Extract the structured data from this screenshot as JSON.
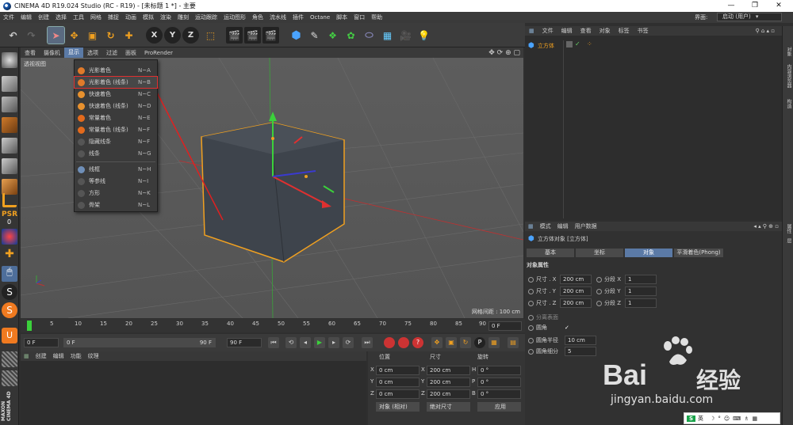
{
  "window": {
    "title": "CINEMA 4D R19.024 Studio (RC - R19) - [未标题 1 *] - 主要"
  },
  "menubar": {
    "items": [
      "文件",
      "编辑",
      "创建",
      "选择",
      "工具",
      "网格",
      "捕捉",
      "动画",
      "模拟",
      "渲染",
      "雕刻",
      "运动跟踪",
      "运动图形",
      "角色",
      "流水线",
      "插件",
      "Octane",
      "脚本",
      "窗口",
      "帮助"
    ],
    "layout_label": "界面:",
    "layout_value": "启动 (用户)"
  },
  "viewport": {
    "menu": [
      "查看",
      "摄像机",
      "显示",
      "选项",
      "过滤",
      "面板",
      "ProRender"
    ],
    "active_menu": "显示",
    "label": "透视视图",
    "grid_info": "网格间距 : 100 cm"
  },
  "dropdown": {
    "items": [
      {
        "label": "光影着色",
        "key": "N~A",
        "color": "#e07a2a"
      },
      {
        "label": "光影着色 (线条)",
        "key": "N~B",
        "color": "#e07a2a",
        "highlight": true
      },
      {
        "label": "快速着色",
        "key": "N~C",
        "color": "#e8912e"
      },
      {
        "label": "快速着色 (线条)",
        "key": "N~D",
        "color": "#e8912e"
      },
      {
        "label": "常量着色",
        "key": "N~E",
        "color": "#e36a1c"
      },
      {
        "label": "常量着色 (线条)",
        "key": "N~F",
        "color": "#e36a1c"
      },
      {
        "label": "隐藏线条",
        "key": "N~F",
        "color": "#555555"
      },
      {
        "label": "线条",
        "key": "N~G",
        "color": "#555555"
      },
      {
        "label": "线框",
        "key": "N~H",
        "color": "#6f8fb8"
      },
      {
        "label": "等参线",
        "key": "N~I",
        "color": "#555555"
      },
      {
        "label": "方形",
        "key": "N~K",
        "color": "#555555"
      },
      {
        "label": "骨架",
        "key": "N~L",
        "color": "#555555"
      }
    ]
  },
  "timeline": {
    "ticks": [
      "0",
      "5",
      "10",
      "15",
      "20",
      "25",
      "30",
      "35",
      "40",
      "45",
      "50",
      "55",
      "60",
      "65",
      "70",
      "75",
      "80",
      "85",
      "90"
    ],
    "frame_display": "0 F"
  },
  "playbar": {
    "start": "0 F",
    "slider_start": "0 F",
    "slider_end": "90 F",
    "end": "90 F"
  },
  "materials": {
    "menu": [
      "创建",
      "编辑",
      "功能",
      "纹理"
    ]
  },
  "coords": {
    "headers": [
      "位置",
      "尺寸",
      "旋转"
    ],
    "rows": [
      {
        "axis": "X",
        "pos": "0 cm",
        "size_axis": "X",
        "size": "200 cm",
        "rot_axis": "H",
        "rot": "0 °"
      },
      {
        "axis": "Y",
        "pos": "0 cm",
        "size_axis": "Y",
        "size": "200 cm",
        "rot_axis": "P",
        "rot": "0 °"
      },
      {
        "axis": "Z",
        "pos": "0 cm",
        "size_axis": "Z",
        "size": "200 cm",
        "rot_axis": "B",
        "rot": "0 °"
      }
    ],
    "mode1": "对象 (相对)",
    "mode2": "绝对尺寸",
    "apply": "应用"
  },
  "objects": {
    "menu": [
      "文件",
      "编辑",
      "查看",
      "对象",
      "标签",
      "书签"
    ],
    "item": "立方体"
  },
  "attributes": {
    "menu": [
      "模式",
      "编辑",
      "用户数据"
    ],
    "object_title": "立方体对象 [立方体]",
    "tabs": [
      "基本",
      "坐标",
      "对象",
      "平滑着色(Phong)"
    ],
    "active_tab": "对象",
    "section": "对象属性",
    "size_rows": [
      {
        "label": "尺寸 . X",
        "value": "200 cm",
        "seg": "分段 X",
        "segv": "1"
      },
      {
        "label": "尺寸 . Y",
        "value": "200 cm",
        "seg": "分段 Y",
        "segv": "1"
      },
      {
        "label": "尺寸 . Z",
        "value": "200 cm",
        "seg": "分段 Z",
        "segv": "1"
      }
    ],
    "separate": "分离表面",
    "fillet": "圆角",
    "fillet_radius_label": "圆角半径",
    "fillet_radius": "10 cm",
    "fillet_sub_label": "圆角细分",
    "fillet_sub": "5"
  },
  "rightstrip": {
    "labels": [
      "对象",
      "内容浏览器",
      "构造",
      "属性",
      "层"
    ]
  },
  "left_labels": {
    "psr": "PSR",
    "psr_value": "0",
    "maxon": "MAXON CINEMA 4D"
  },
  "watermark": {
    "brand": "Bai",
    "brand2": "经验",
    "url": "jingyan.baidu.com"
  },
  "status": {
    "ime": "英"
  }
}
